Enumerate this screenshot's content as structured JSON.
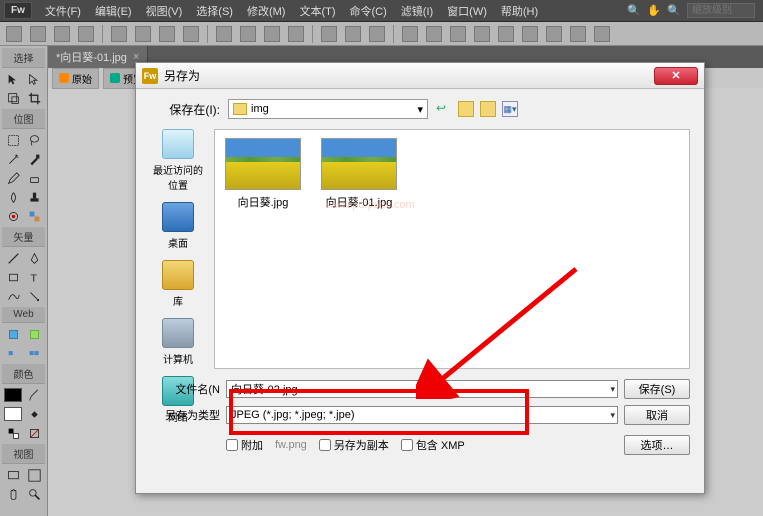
{
  "app": {
    "logo": "Fw"
  },
  "menu": {
    "items": [
      "文件(F)",
      "编辑(E)",
      "视图(V)",
      "选择(S)",
      "修改(M)",
      "文本(T)",
      "命令(C)",
      "滤镜(I)",
      "窗口(W)",
      "帮助(H)"
    ],
    "search_placeholder": "缩放级别"
  },
  "tab": {
    "title": "*向日葵-01.jpg",
    "sub_original": "原始",
    "sub_preview": "预览"
  },
  "tools": {
    "sec_select": "选择",
    "sec_bitmap": "位图",
    "sec_vector": "矢量",
    "sec_web": "Web",
    "sec_colors": "颜色",
    "sec_view": "视图"
  },
  "dialog": {
    "title": "另存为",
    "save_in_label": "保存在(I):",
    "folder": "img",
    "places": {
      "recent": "最近访问的位置",
      "desktop": "桌面",
      "library": "库",
      "computer": "计算机",
      "network": "网络"
    },
    "files": [
      {
        "name": "向日葵.jpg"
      },
      {
        "name": "向日葵-01.jpg"
      }
    ],
    "filename_label": "文件名(N",
    "filetype_label": "另存为类型",
    "filename_value": "向日葵-02.jpg",
    "filetype_value": "JPEG (*.jpg; *.jpeg; *.jpe)",
    "save_btn": "保存(S)",
    "cancel_btn": "取消",
    "options_btn": "选项…",
    "attach": "附加",
    "attach_name": "fw.png",
    "save_copy": "另存为副本",
    "include_xmp": "包含 XMP"
  },
  "watermark": "www.pdfpass.com"
}
